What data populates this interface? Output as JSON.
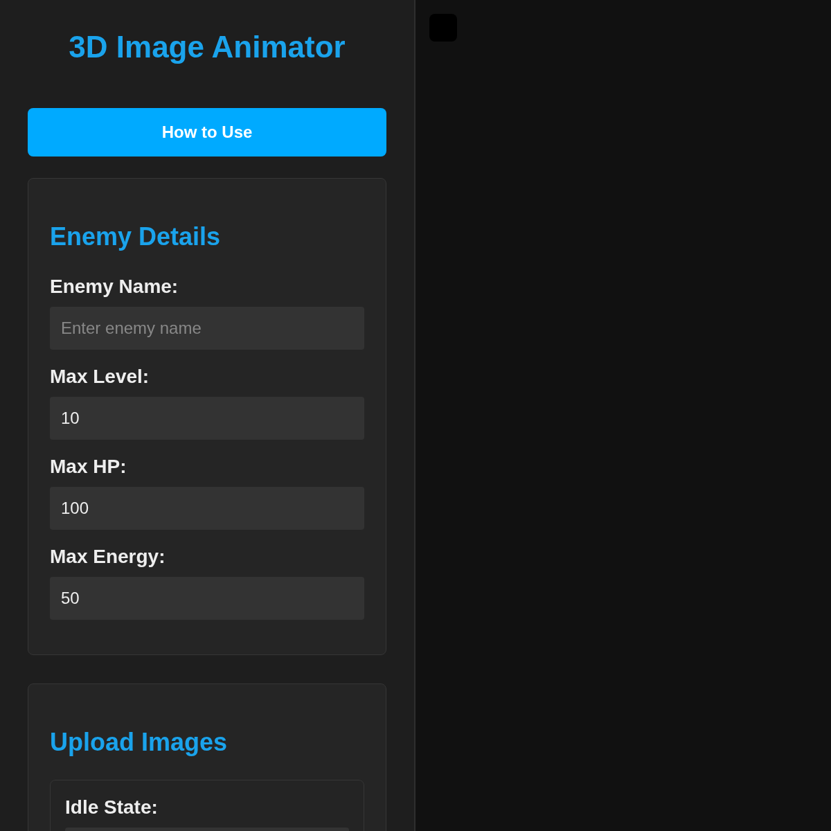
{
  "title": "3D Image Animator",
  "help_button": "How to Use",
  "sections": [
    {
      "kind": "fields",
      "heading": "Enemy Details",
      "fields": [
        {
          "label": "Enemy Name:",
          "placeholder": "Enter enemy name"
        },
        {
          "label": "Max Level:",
          "value": "10"
        },
        {
          "label": "Max HP:",
          "value": "100"
        },
        {
          "label": "Max Energy:",
          "value": "50"
        }
      ]
    },
    {
      "kind": "uploads",
      "heading": "Upload Images",
      "uploads": [
        {
          "label": "Idle State:"
        }
      ]
    }
  ]
}
